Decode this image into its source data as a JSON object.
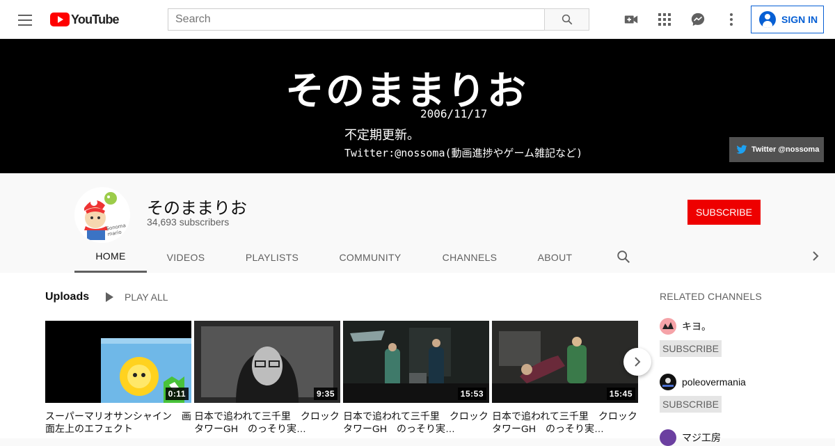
{
  "header": {
    "logo_text": "YouTube",
    "search_placeholder": "Search",
    "signin_label": "SIGN IN"
  },
  "banner": {
    "title": "そのままりお",
    "date": "2006/11/17",
    "line1": "不定期更新。",
    "line2": "Twitter:@nossoma(動画進捗やゲーム雑記など)",
    "twitter_link": "Twitter @nossoma"
  },
  "channel": {
    "name": "そのままりお",
    "subscribers": "34,693 subscribers",
    "subscribe_label": "SUBSCRIBE",
    "tabs": [
      {
        "label": "HOME",
        "active": true
      },
      {
        "label": "VIDEOS",
        "active": false
      },
      {
        "label": "PLAYLISTS",
        "active": false
      },
      {
        "label": "COMMUNITY",
        "active": false
      },
      {
        "label": "CHANNELS",
        "active": false
      },
      {
        "label": "ABOUT",
        "active": false
      }
    ]
  },
  "uploads": {
    "title": "Uploads",
    "play_all": "PLAY ALL",
    "videos": [
      {
        "title": "スーパーマリオサンシャイン　画面左上のエフェクト",
        "duration": "0:11"
      },
      {
        "title": "日本で追われて三千里　クロックタワーGH　のっそり実…",
        "duration": "9:35"
      },
      {
        "title": "日本で追われて三千里　クロックタワーGH　のっそり実…",
        "duration": "15:53"
      },
      {
        "title": "日本で追われて三千里　クロックタワーGH　のっそり実…",
        "duration": "15:45"
      }
    ]
  },
  "related": {
    "title": "RELATED CHANNELS",
    "subscribe_label": "SUBSCRIBE",
    "channels": [
      {
        "name": "キヨ。"
      },
      {
        "name": "poleovermania"
      },
      {
        "name": "マジ工房"
      }
    ]
  },
  "colors": {
    "brand_red": "#ff0000",
    "subscribe_red": "#ee0000",
    "link_blue": "#065fd4"
  }
}
